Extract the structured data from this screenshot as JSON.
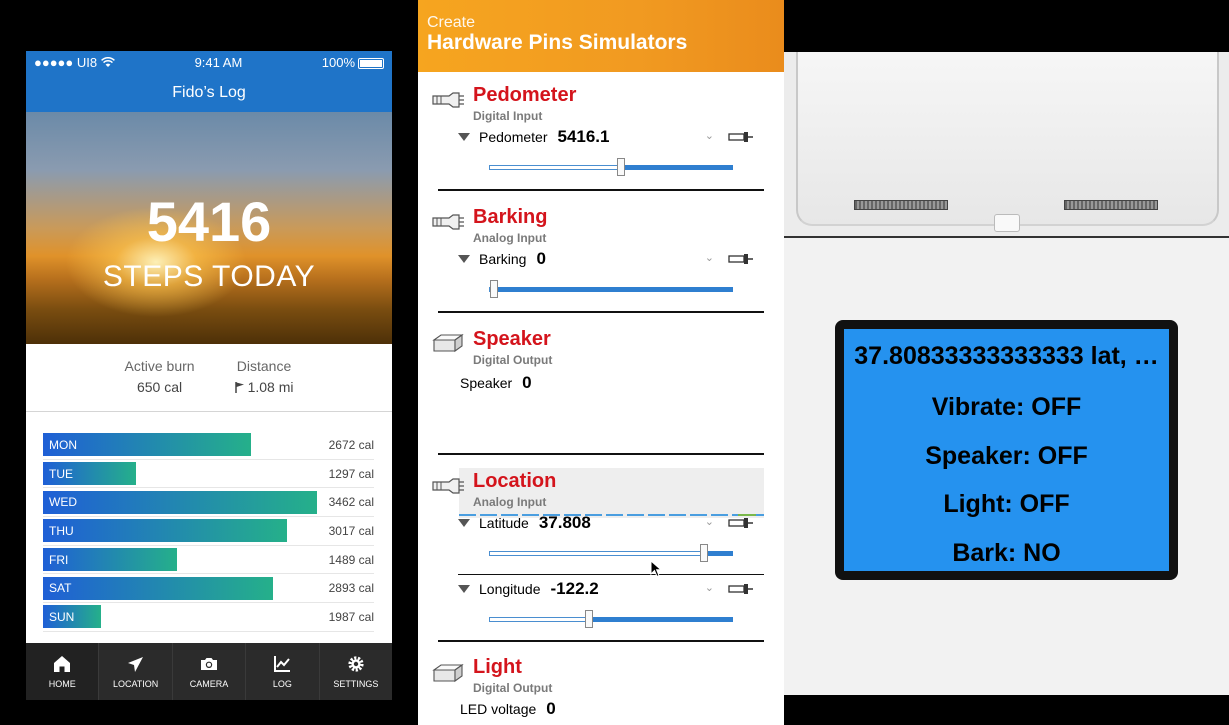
{
  "phone": {
    "status": {
      "carrier": "●●●●● UI8",
      "time": "9:41 AM",
      "battery": "100%"
    },
    "title": "Fido’s Log",
    "hero": {
      "steps": "5416",
      "label": "STEPS TODAY"
    },
    "stats": [
      {
        "label": "Active burn",
        "value": "650 cal"
      },
      {
        "label": "Distance",
        "value": "1.08 mi"
      }
    ],
    "days": [
      {
        "day": "MON",
        "cal": "2672 cal",
        "fraction": 0.76
      },
      {
        "day": "TUE",
        "cal": "1297 cal",
        "fraction": 0.34
      },
      {
        "day": "WED",
        "cal": "3462 cal",
        "fraction": 1.0
      },
      {
        "day": "THU",
        "cal": "3017 cal",
        "fraction": 0.89
      },
      {
        "day": "FRI",
        "cal": "1489 cal",
        "fraction": 0.49
      },
      {
        "day": "SAT",
        "cal": "2893 cal",
        "fraction": 0.84
      },
      {
        "day": "SUN",
        "cal": "1987 cal",
        "fraction": 0.21
      }
    ],
    "tabs": [
      {
        "label": "HOME",
        "icon": "home-icon"
      },
      {
        "label": "LOCATION",
        "icon": "location-arrow-icon"
      },
      {
        "label": "CAMERA",
        "icon": "camera-icon"
      },
      {
        "label": "LOG",
        "icon": "chart-icon"
      },
      {
        "label": "SETTINGS",
        "icon": "gear-icon"
      }
    ]
  },
  "simulator": {
    "header_sub": "Create",
    "header_title": "Hardware Pins Simulators",
    "pedometer": {
      "title": "Pedometer",
      "type": "Digital Input",
      "control": "Pedometer",
      "value": "5416.1",
      "slider": 0.54
    },
    "barking": {
      "title": "Barking",
      "type": "Analog Input",
      "control": "Barking",
      "value": "0",
      "slider": 0.02
    },
    "speaker": {
      "title": "Speaker",
      "type": "Digital Output",
      "control": "Speaker",
      "value": "0"
    },
    "location": {
      "title": "Location",
      "type": "Analog Input",
      "latitude": {
        "label": "Latitude",
        "value": "37.808",
        "slider": 0.88
      },
      "longitude": {
        "label": "Longitude",
        "value": "-122.2",
        "slider": 0.41
      }
    },
    "light": {
      "title": "Light",
      "type": "Digital Output",
      "control": "LED voltage",
      "value": "0"
    }
  },
  "device": {
    "lcd_lines": [
      "37.80833333333333 lat, …",
      "Vibrate: OFF",
      "Speaker: OFF",
      "Light: OFF",
      "Bark: NO"
    ]
  },
  "colors": {
    "phone_blue": "#1f74c8",
    "sim_orange": "#f6a51f",
    "pin_red": "#d4141c",
    "lcd_blue": "#2592ef"
  }
}
